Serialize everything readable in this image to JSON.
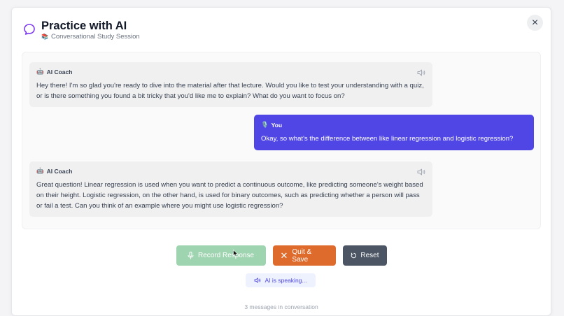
{
  "header": {
    "title": "Practice with AI",
    "subtitle": "Conversational Study Session",
    "icon": "chat-bubble-icon",
    "close_label": "×"
  },
  "messages": [
    {
      "role": "ai",
      "sender": "AI Coach",
      "text": "Hey there! I'm so glad you're ready to dive into the material after that lecture. Would you like to test your understanding with a quiz, or is there something you found a bit tricky that you'd like me to explain? What do you want to focus on?"
    },
    {
      "role": "user",
      "sender": "You",
      "text": "Okay, so what's the difference between like linear regression and logistic regression?"
    },
    {
      "role": "ai",
      "sender": "AI Coach",
      "text": "Great question! Linear regression is used when you want to predict a continuous outcome, like predicting someone's weight based on their height. Logistic regression, on the other hand, is used for binary outcomes, such as predicting whether a person will pass or fail a test. Can you think of an example where you might use logistic regression?"
    }
  ],
  "controls": {
    "record_label": "Record Response",
    "quit_label": "Quit & Save",
    "reset_label": "Reset"
  },
  "status": {
    "speaking": "AI is speaking...",
    "message_count": "3 messages in conversation"
  },
  "colors": {
    "accent": "#5046e5",
    "record": "#9fd4b0",
    "quit": "#de6a2b",
    "reset": "#4b5563"
  }
}
